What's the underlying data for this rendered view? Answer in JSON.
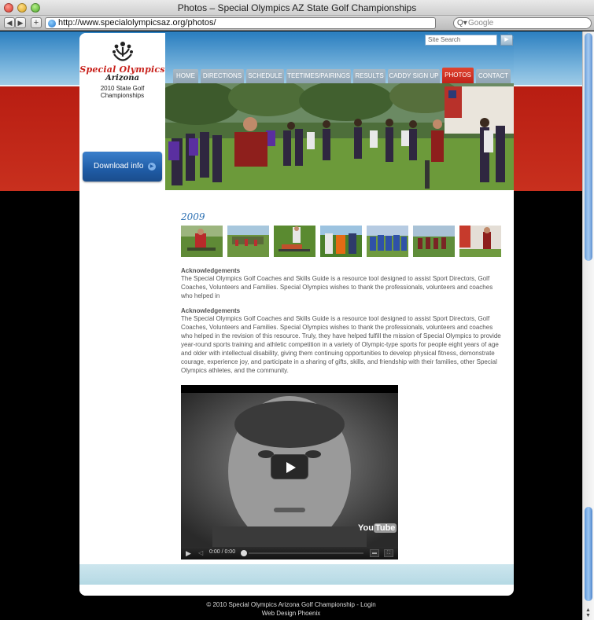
{
  "browser": {
    "window_title": "Photos  – Special Olympics AZ State Golf Championships",
    "url": "http://www.specialolympicsaz.org/photos/",
    "search_placeholder": "Google",
    "back_glyph": "◀",
    "forward_glyph": "▶",
    "add_glyph": "+",
    "reload_glyph": "↻",
    "search_glyph": "Q▾"
  },
  "site": {
    "logo_name": "Special Olympics",
    "logo_region": "Arizona",
    "championship": "2010 State Golf Championships",
    "download_label": "Download info",
    "download_icon": "arrow-right-circle-icon",
    "search_placeholder": "Site Search",
    "search_go_glyph": "▶",
    "nav": [
      {
        "label": "HOME",
        "active": false
      },
      {
        "label": "DIRECTIONS",
        "active": false
      },
      {
        "label": "SCHEDULE",
        "active": false
      },
      {
        "label": "TEETIMES/PAIRINGS",
        "active": false
      },
      {
        "label": "RESULTS",
        "active": false
      },
      {
        "label": "CADDY SIGN UP",
        "active": false
      },
      {
        "label": "PHOTOS",
        "active": true
      },
      {
        "label": "CONTACT",
        "active": false
      }
    ],
    "colors": {
      "brand_red": "#c8211b",
      "nav_active": "#d8321f",
      "nav_inactive": "#98aab8",
      "download_blue": "#1f5ca6",
      "year_blue": "#2b6fb2"
    }
  },
  "content": {
    "year": "2009",
    "thumbnail_count": 7,
    "ack1_title": "Acknowledgements",
    "ack1_text": "The Special Olympics Golf Coaches and Skills Guide is a resource tool designed to assist Sport Directors, Golf Coaches, Volunteers and Families. Special Olympics wishes to thank the professionals, volunteers and coaches who helped in",
    "ack2_title": "Acknowledgements",
    "ack2_text": "The Special Olympics Golf Coaches and Skills Guide is a resource tool designed to assist Sport Directors, Golf Coaches, Volunteers and Families. Special Olympics wishes to thank the professionals, volunteers and coaches who helped in the revision of this resource. Truly, they have helped fulfill the mission of Special Olympics to provide year-round sports training and athletic competition in a variety of Olympic-type sports for people eight years of age and older with intellectual disability, giving them continuing opportunities to develop physical fitness, demonstrate courage, experience joy, and participate in a sharing of gifts, skills, and friendship with their families, other Special Olympics athletes, and the community.",
    "video": {
      "time": "0:00 / 0:00",
      "logo_you": "You",
      "logo_tube": "Tube",
      "play_glyph": "▶",
      "volume_glyph": "◁"
    }
  },
  "footer": {
    "copyright": "© 2010 Special Olympics Arizona Golf Championship - Login",
    "credit": "Web Design Phoenix"
  }
}
